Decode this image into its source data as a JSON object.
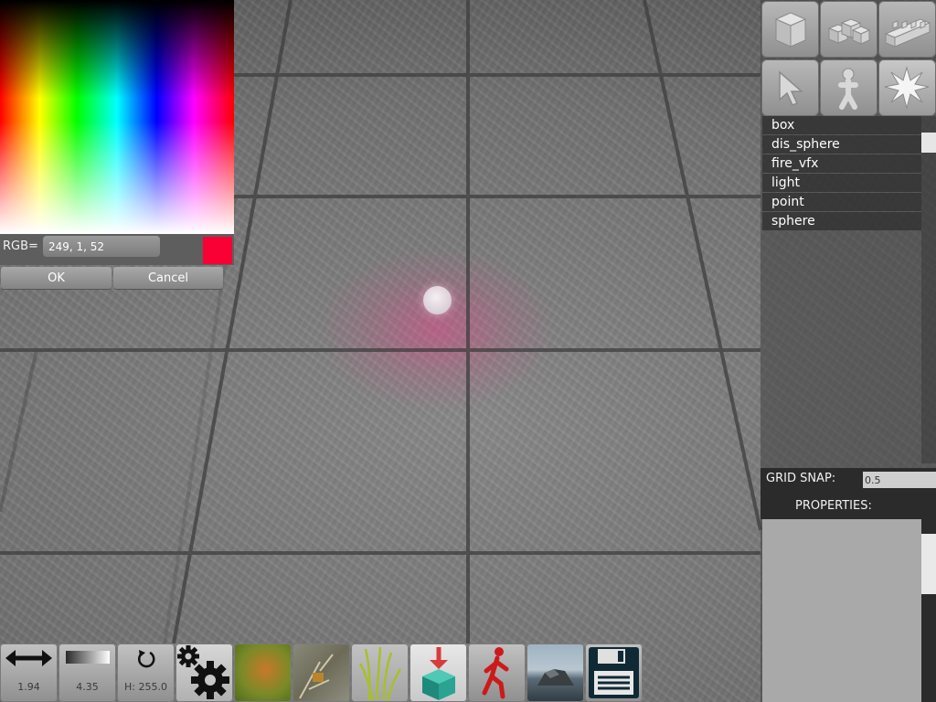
{
  "color_picker": {
    "rgb_label": "RGB=",
    "rgb_value": "249, 1, 52",
    "selected_color": "#f90134",
    "ok_label": "OK",
    "cancel_label": "Cancel"
  },
  "toolbox": {
    "row1": [
      "box-icon",
      "boxes-icon",
      "wall-icon"
    ],
    "row2": [
      "cursor-icon",
      "character-icon",
      "burst-icon"
    ]
  },
  "object_list": {
    "items": [
      "box",
      "dis_sphere",
      "fire_vfx",
      "light",
      "point",
      "sphere"
    ]
  },
  "grid_snap": {
    "label": "GRID SNAP:",
    "value": "0.5"
  },
  "properties": {
    "label": "PROPERTIES:"
  },
  "bottom_toolbar": {
    "size_value": "1.94",
    "intensity_value": "4.35",
    "rotation_value": "H: 255.0",
    "buttons": [
      "resize-arrows-icon",
      "gradient-bar-icon",
      "rotate-icon",
      "settings-gears-icon",
      "moss-texture-icon",
      "plant-texture-icon",
      "grass-texture-icon",
      "place-object-icon",
      "walk-mode-icon",
      "terrain-rock-icon",
      "save-floppy-icon"
    ]
  },
  "colors": {
    "accent_light": "#e8468c",
    "panel_dark": "#2b2b2b"
  }
}
